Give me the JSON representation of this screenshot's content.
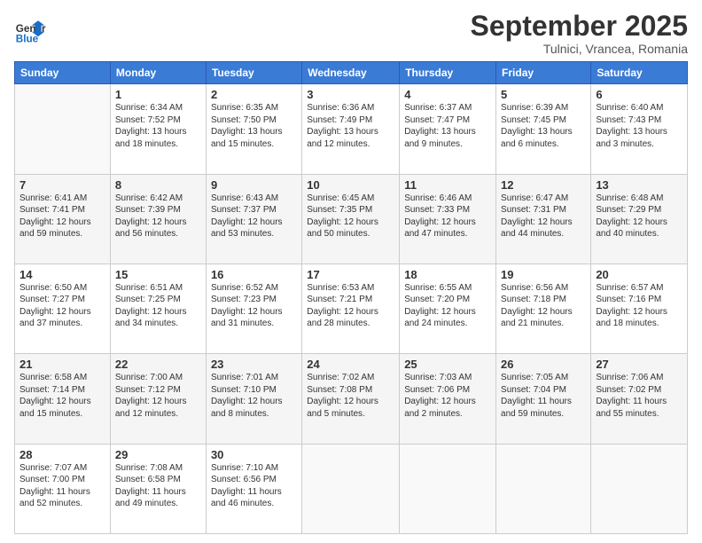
{
  "header": {
    "logo_general": "General",
    "logo_blue": "Blue",
    "month": "September 2025",
    "location": "Tulnici, Vrancea, Romania"
  },
  "days_of_week": [
    "Sunday",
    "Monday",
    "Tuesday",
    "Wednesday",
    "Thursday",
    "Friday",
    "Saturday"
  ],
  "weeks": [
    [
      {
        "day": "",
        "content": ""
      },
      {
        "day": "1",
        "content": "Sunrise: 6:34 AM\nSunset: 7:52 PM\nDaylight: 13 hours\nand 18 minutes."
      },
      {
        "day": "2",
        "content": "Sunrise: 6:35 AM\nSunset: 7:50 PM\nDaylight: 13 hours\nand 15 minutes."
      },
      {
        "day": "3",
        "content": "Sunrise: 6:36 AM\nSunset: 7:49 PM\nDaylight: 13 hours\nand 12 minutes."
      },
      {
        "day": "4",
        "content": "Sunrise: 6:37 AM\nSunset: 7:47 PM\nDaylight: 13 hours\nand 9 minutes."
      },
      {
        "day": "5",
        "content": "Sunrise: 6:39 AM\nSunset: 7:45 PM\nDaylight: 13 hours\nand 6 minutes."
      },
      {
        "day": "6",
        "content": "Sunrise: 6:40 AM\nSunset: 7:43 PM\nDaylight: 13 hours\nand 3 minutes."
      }
    ],
    [
      {
        "day": "7",
        "content": "Sunrise: 6:41 AM\nSunset: 7:41 PM\nDaylight: 12 hours\nand 59 minutes."
      },
      {
        "day": "8",
        "content": "Sunrise: 6:42 AM\nSunset: 7:39 PM\nDaylight: 12 hours\nand 56 minutes."
      },
      {
        "day": "9",
        "content": "Sunrise: 6:43 AM\nSunset: 7:37 PM\nDaylight: 12 hours\nand 53 minutes."
      },
      {
        "day": "10",
        "content": "Sunrise: 6:45 AM\nSunset: 7:35 PM\nDaylight: 12 hours\nand 50 minutes."
      },
      {
        "day": "11",
        "content": "Sunrise: 6:46 AM\nSunset: 7:33 PM\nDaylight: 12 hours\nand 47 minutes."
      },
      {
        "day": "12",
        "content": "Sunrise: 6:47 AM\nSunset: 7:31 PM\nDaylight: 12 hours\nand 44 minutes."
      },
      {
        "day": "13",
        "content": "Sunrise: 6:48 AM\nSunset: 7:29 PM\nDaylight: 12 hours\nand 40 minutes."
      }
    ],
    [
      {
        "day": "14",
        "content": "Sunrise: 6:50 AM\nSunset: 7:27 PM\nDaylight: 12 hours\nand 37 minutes."
      },
      {
        "day": "15",
        "content": "Sunrise: 6:51 AM\nSunset: 7:25 PM\nDaylight: 12 hours\nand 34 minutes."
      },
      {
        "day": "16",
        "content": "Sunrise: 6:52 AM\nSunset: 7:23 PM\nDaylight: 12 hours\nand 31 minutes."
      },
      {
        "day": "17",
        "content": "Sunrise: 6:53 AM\nSunset: 7:21 PM\nDaylight: 12 hours\nand 28 minutes."
      },
      {
        "day": "18",
        "content": "Sunrise: 6:55 AM\nSunset: 7:20 PM\nDaylight: 12 hours\nand 24 minutes."
      },
      {
        "day": "19",
        "content": "Sunrise: 6:56 AM\nSunset: 7:18 PM\nDaylight: 12 hours\nand 21 minutes."
      },
      {
        "day": "20",
        "content": "Sunrise: 6:57 AM\nSunset: 7:16 PM\nDaylight: 12 hours\nand 18 minutes."
      }
    ],
    [
      {
        "day": "21",
        "content": "Sunrise: 6:58 AM\nSunset: 7:14 PM\nDaylight: 12 hours\nand 15 minutes."
      },
      {
        "day": "22",
        "content": "Sunrise: 7:00 AM\nSunset: 7:12 PM\nDaylight: 12 hours\nand 12 minutes."
      },
      {
        "day": "23",
        "content": "Sunrise: 7:01 AM\nSunset: 7:10 PM\nDaylight: 12 hours\nand 8 minutes."
      },
      {
        "day": "24",
        "content": "Sunrise: 7:02 AM\nSunset: 7:08 PM\nDaylight: 12 hours\nand 5 minutes."
      },
      {
        "day": "25",
        "content": "Sunrise: 7:03 AM\nSunset: 7:06 PM\nDaylight: 12 hours\nand 2 minutes."
      },
      {
        "day": "26",
        "content": "Sunrise: 7:05 AM\nSunset: 7:04 PM\nDaylight: 11 hours\nand 59 minutes."
      },
      {
        "day": "27",
        "content": "Sunrise: 7:06 AM\nSunset: 7:02 PM\nDaylight: 11 hours\nand 55 minutes."
      }
    ],
    [
      {
        "day": "28",
        "content": "Sunrise: 7:07 AM\nSunset: 7:00 PM\nDaylight: 11 hours\nand 52 minutes."
      },
      {
        "day": "29",
        "content": "Sunrise: 7:08 AM\nSunset: 6:58 PM\nDaylight: 11 hours\nand 49 minutes."
      },
      {
        "day": "30",
        "content": "Sunrise: 7:10 AM\nSunset: 6:56 PM\nDaylight: 11 hours\nand 46 minutes."
      },
      {
        "day": "",
        "content": ""
      },
      {
        "day": "",
        "content": ""
      },
      {
        "day": "",
        "content": ""
      },
      {
        "day": "",
        "content": ""
      }
    ]
  ]
}
